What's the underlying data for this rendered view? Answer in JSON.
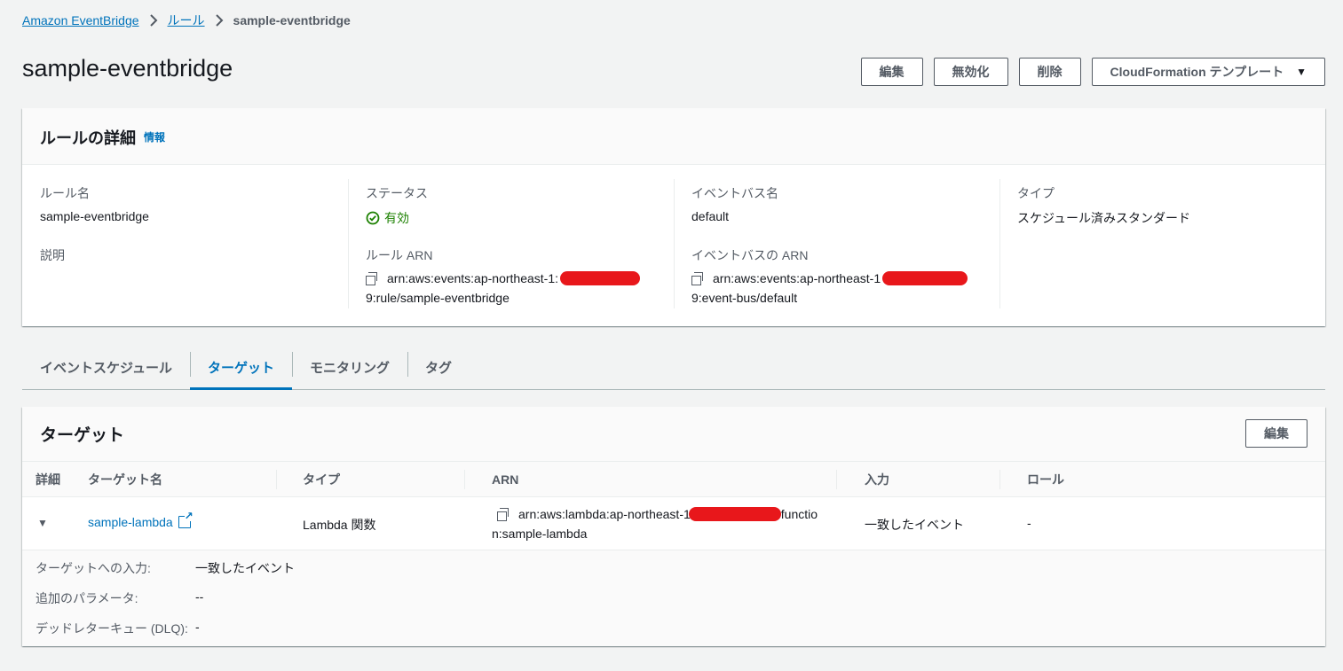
{
  "breadcrumb": {
    "items": [
      "Amazon EventBridge",
      "ルール"
    ],
    "current": "sample-eventbridge"
  },
  "header": {
    "title": "sample-eventbridge",
    "actions": {
      "edit": "編集",
      "disable": "無効化",
      "delete": "削除",
      "cloudformation": "CloudFormation テンプレート"
    }
  },
  "rule_details": {
    "title": "ルールの詳細",
    "info": "情報",
    "rule_name_label": "ルール名",
    "rule_name": "sample-eventbridge",
    "description_label": "説明",
    "status_label": "ステータス",
    "status": "有効",
    "rule_arn_label": "ルール ARN",
    "rule_arn_line1": "arn:aws:events:ap-northeast-1:",
    "rule_arn_line2": "9:rule/sample-eventbridge",
    "event_bus_label": "イベントバス名",
    "event_bus": "default",
    "event_bus_arn_label": "イベントバスの ARN",
    "event_bus_arn_line1": "arn:aws:events:ap-northeast-1",
    "event_bus_arn_line2": "9:event-bus/default",
    "type_label": "タイプ",
    "type": "スケジュール済みスタンダード"
  },
  "tabs": [
    "イベントスケジュール",
    "ターゲット",
    "モニタリング",
    "タグ"
  ],
  "active_tab": "ターゲット",
  "targets": {
    "title": "ターゲット",
    "edit": "編集",
    "columns": [
      "詳細",
      "ターゲット名",
      "タイプ",
      "ARN",
      "入力",
      "ロール"
    ],
    "row": {
      "name": "sample-lambda",
      "type": "Lambda 関数",
      "arn_line1_start": "arn:aws:lambda:ap-northeast-1",
      "arn_line1_end": "functio",
      "arn_line2": "n:sample-lambda",
      "input": "一致したイベント",
      "role": "-"
    },
    "details": {
      "input_label": "ターゲットへの入力:",
      "input_value": "一致したイベント",
      "params_label": "追加のパラメータ:",
      "params_value": "--",
      "dlq_label": "デッドレターキュー (DLQ):",
      "dlq_value": "-"
    }
  },
  "colors": {
    "link": "#0073bb",
    "success": "#1d8102",
    "redaction": "#e8171b"
  }
}
